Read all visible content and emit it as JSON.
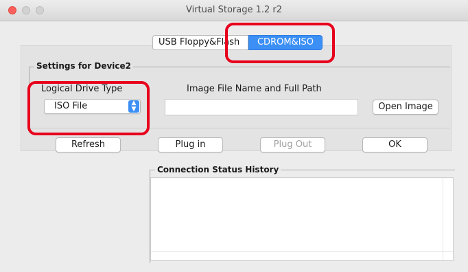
{
  "window": {
    "title": "Virtual Storage 1.2 r2"
  },
  "tabs": [
    {
      "label": "USB Floppy&Flash"
    },
    {
      "label": "CDROM&ISO"
    }
  ],
  "device_group": {
    "legend": "Settings for Device2"
  },
  "drive_type": {
    "label": "Logical Drive Type",
    "selected": "ISO File"
  },
  "image_path": {
    "label": "Image File Name and Full Path",
    "value": ""
  },
  "buttons": {
    "open_image": "Open Image",
    "refresh": "Refresh",
    "plug_in": "Plug in",
    "plug_out": "Plug Out",
    "ok": "OK"
  },
  "history": {
    "legend": "Connection Status History"
  },
  "colors": {
    "accent": "#3b8ff5",
    "highlight": "#e8001c"
  },
  "icons": {
    "select_arrow": "updown-chevron-icon"
  }
}
